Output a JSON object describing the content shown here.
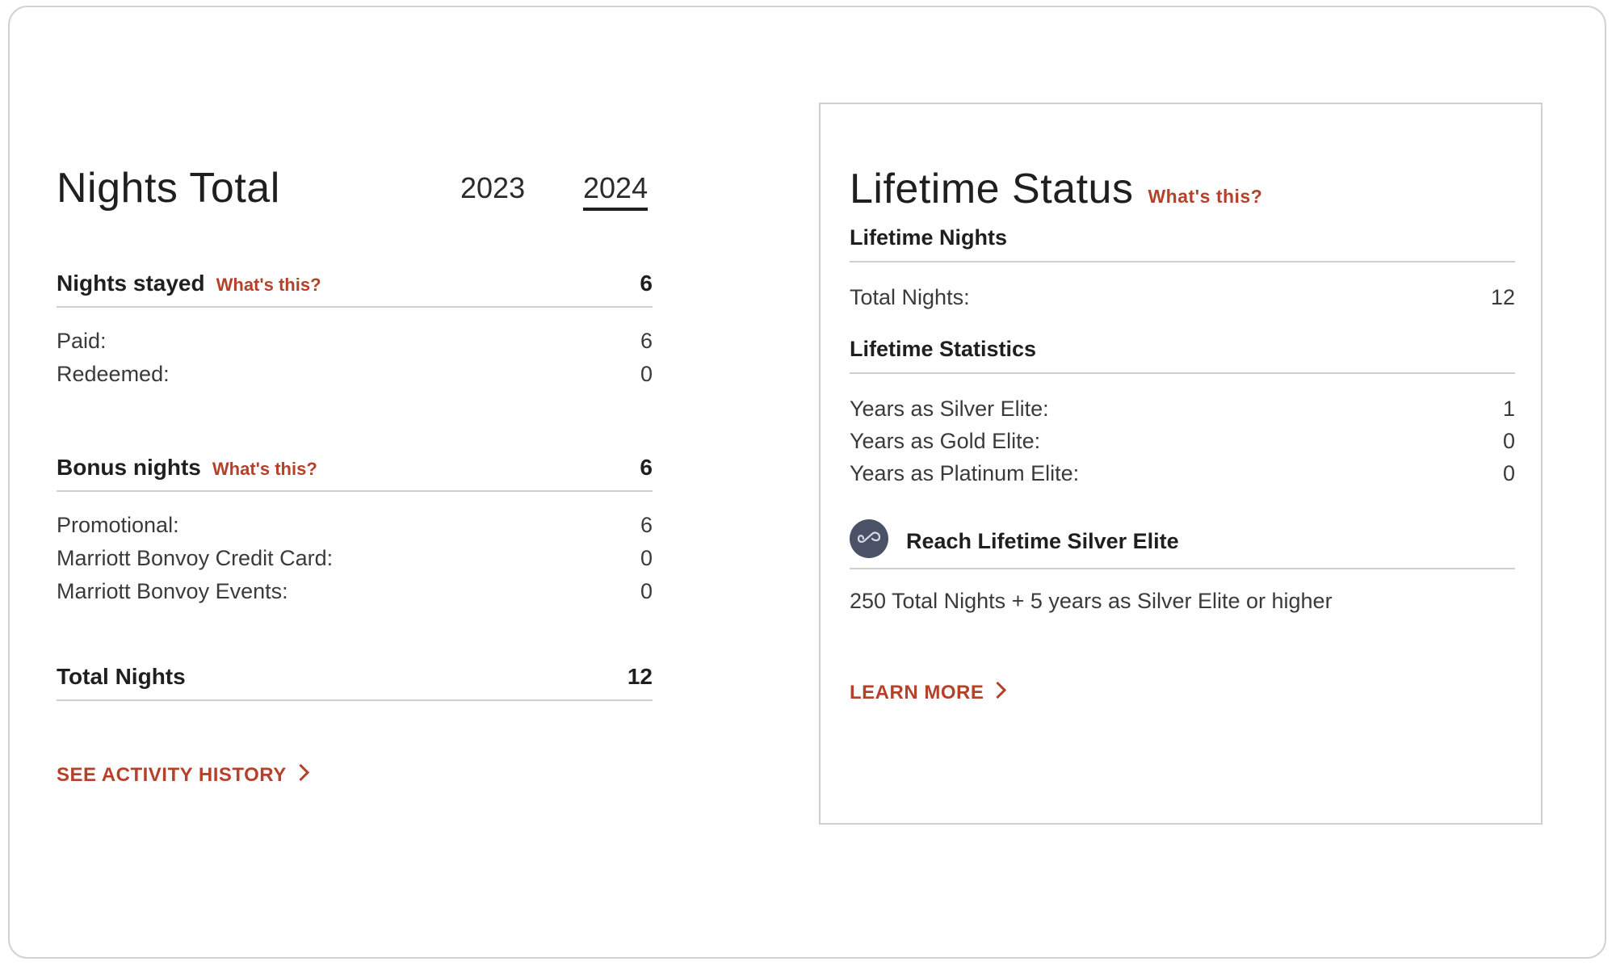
{
  "nights_total": {
    "title": "Nights Total",
    "years": [
      "2023",
      "2024"
    ],
    "selected_year": "2024",
    "nights_stayed": {
      "label": "Nights stayed",
      "whats_this": "What's this?",
      "value": "6",
      "rows": [
        {
          "label": "Paid:",
          "value": "6"
        },
        {
          "label": "Redeemed:",
          "value": "0"
        }
      ]
    },
    "bonus_nights": {
      "label": "Bonus nights",
      "whats_this": "What's this?",
      "value": "6",
      "rows": [
        {
          "label": "Promotional:",
          "value": "6"
        },
        {
          "label": "Marriott Bonvoy Credit Card:",
          "value": "0"
        },
        {
          "label": "Marriott Bonvoy Events:",
          "value": "0"
        }
      ]
    },
    "total": {
      "label": "Total Nights",
      "value": "12"
    },
    "cta": "SEE ACTIVITY HISTORY"
  },
  "lifetime_status": {
    "title": "Lifetime Status",
    "whats_this": "What's this?",
    "lifetime_nights": {
      "label": "Lifetime Nights",
      "rows": [
        {
          "label": "Total Nights:",
          "value": "12"
        }
      ]
    },
    "lifetime_statistics": {
      "label": "Lifetime Statistics",
      "rows": [
        {
          "label": "Years as Silver Elite:",
          "value": "1"
        },
        {
          "label": "Years as Gold Elite:",
          "value": "0"
        },
        {
          "label": "Years as Platinum Elite:",
          "value": "0"
        }
      ]
    },
    "goal": {
      "icon": "infinity-icon",
      "label": "Reach Lifetime Silver Elite",
      "description": "250 Total Nights + 5 years as Silver Elite or higher"
    },
    "cta": "LEARN MORE"
  },
  "colors": {
    "accent": "#b5412a",
    "text": "#1f1f1f",
    "divider": "#cfcfcf",
    "icon_bg": "#4b5166"
  }
}
